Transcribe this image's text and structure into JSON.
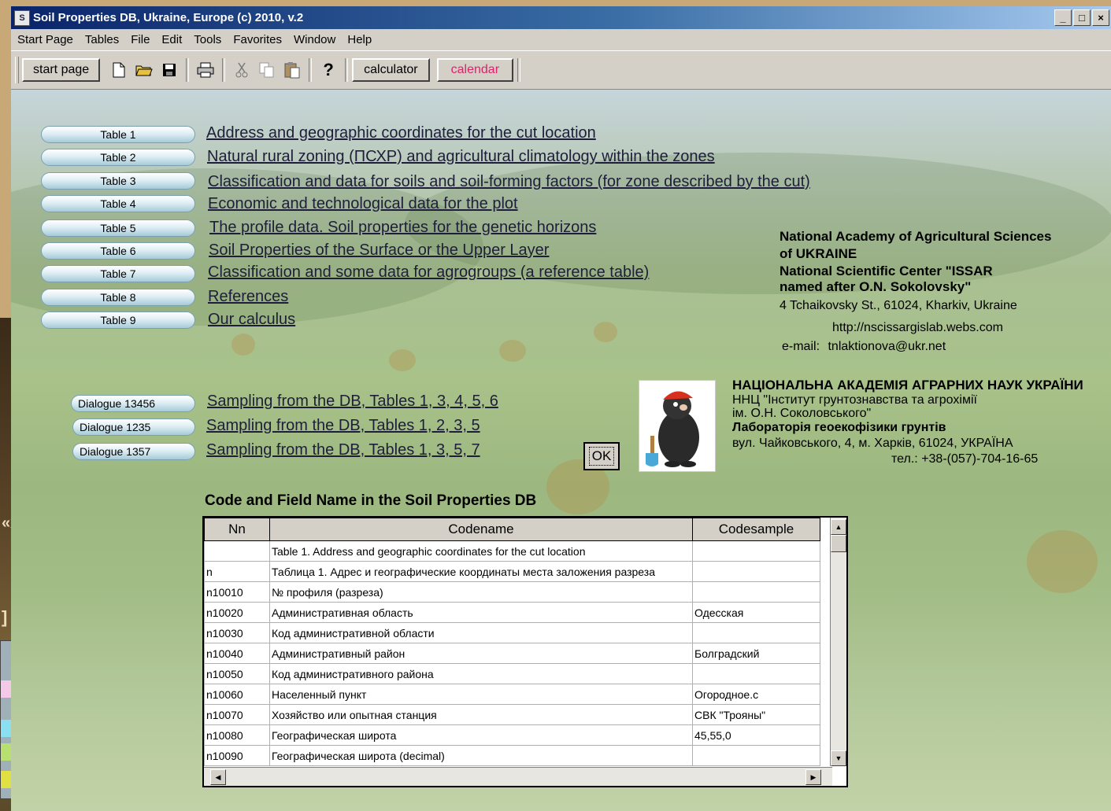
{
  "window": {
    "title": "Soil Properties DB, Ukraine, Europe  (c) 2010, v.2",
    "controls": [
      "_",
      "□",
      "×"
    ]
  },
  "menu": [
    "Start Page",
    "Tables",
    "File",
    "Edit",
    "Tools",
    "Favorites",
    "Window",
    "Help"
  ],
  "toolbar": {
    "start_page": "start page",
    "help": "?",
    "calculator": "calculator",
    "calendar": "calendar",
    "calendar_color": "#e0206a"
  },
  "tables": [
    {
      "button": "Table 1",
      "link": "Address and geographic coordinates for the cut location"
    },
    {
      "button": "Table 2",
      "link": "Natural rural zoning (ПСХР) and agricultural climatology within the zones"
    },
    {
      "button": "Table 3",
      "link": "Classification and data for soils and soil-forming factors (for zone described by the cut)"
    },
    {
      "button": "Table 4",
      "link": "Economic and technological data for the plot"
    },
    {
      "button": "Table 5",
      "link": "The profile data. Soil properties for the genetic horizons"
    },
    {
      "button": "Table 6",
      "link": "Soil Properties of the Surface or the Upper Layer"
    },
    {
      "button": "Table 7",
      "link": "Classification and some data for agrogroups (a reference table)"
    },
    {
      "button": "Table 8",
      "link": "References"
    },
    {
      "button": "Table 9",
      "link": "Our calculus"
    }
  ],
  "dialogues": [
    {
      "button": "Dialogue 13456",
      "link": "Sampling from the DB, Tables 1, 3, 4, 5, 6"
    },
    {
      "button": "Dialogue 1235",
      "link": "Sampling from the DB, Tables 1, 2, 3, 5"
    },
    {
      "button": "Dialogue 1357",
      "link": "Sampling from the DB, Tables 1, 3, 5, 7"
    }
  ],
  "ok_button": "OK",
  "info_en": {
    "line1": "National Academy of Agricultural Sciences",
    "line2": "of UKRAINE",
    "line3": "National Scientific Center \"ISSAR",
    "line4": "named after O.N. Sokolovsky\"",
    "line5": "4 Tchaikovsky St., 61024, Kharkiv, Ukraine",
    "website": "http://nscissargislab.webs.com",
    "email_label": "e-mail:",
    "email": "tnlaktionova@ukr.net"
  },
  "info_ua": {
    "line1": "НАЦІОНАЛЬНА АКАДЕМІЯ АГРАРНИХ НАУК УКРАЇНИ",
    "line2": "ННЦ \"Інститут грунтознавства та агрохімії",
    "line3": "ім. О.Н. Соколовського\"",
    "line4": "Лабораторія геоекофізики грунтів",
    "line5": "вул. Чайковського, 4, м. Харків, 61024, УКРАЇНА",
    "phone": "тел.: +38-(057)-704-16-65"
  },
  "grid": {
    "title": "Code and Field Name in the Soil Properties DB",
    "columns": [
      "Nn",
      "Codename",
      "Codesample"
    ],
    "rows": [
      [
        "",
        "Table 1. Address and geographic coordinates for the cut location",
        ""
      ],
      [
        "n",
        "Таблица 1. Адрес и географические координаты места заложения разреза",
        ""
      ],
      [
        "n10010",
        "№ профиля (разреза)",
        ""
      ],
      [
        "n10020",
        "Административная область",
        "Одесская"
      ],
      [
        "n10030",
        "Код административной области",
        ""
      ],
      [
        "n10040",
        "Административный район",
        "Болградский"
      ],
      [
        "n10050",
        "Код административного района",
        ""
      ],
      [
        "n10060",
        "Населенный пункт",
        "Огородное.с"
      ],
      [
        "n10070",
        "Хозяйство или опытная станция",
        "СВК \"Трояны\""
      ],
      [
        "n10080",
        "Географическая широта",
        "45,55,0"
      ],
      [
        "n10090",
        "Географическая широта (decimal)",
        ""
      ]
    ]
  },
  "backdrop_fragments": {
    "text1": "«x",
    "text2": "] »"
  }
}
